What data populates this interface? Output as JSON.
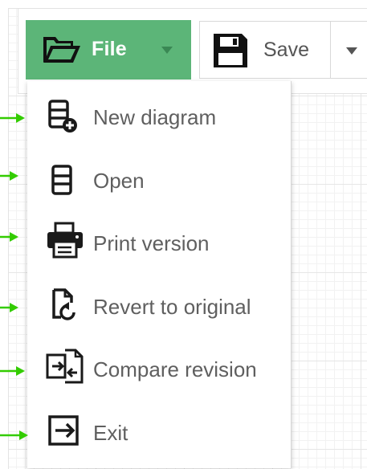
{
  "toolbar": {
    "file_label": "File",
    "save_label": "Save"
  },
  "file_menu": {
    "items": [
      {
        "label": "New diagram",
        "icon": "new-diagram-icon"
      },
      {
        "label": "Open",
        "icon": "open-icon"
      },
      {
        "label": "Print version",
        "icon": "printer-icon"
      },
      {
        "label": "Revert to original",
        "icon": "revert-icon"
      },
      {
        "label": "Compare revision",
        "icon": "compare-icon"
      },
      {
        "label": "Exit",
        "icon": "exit-icon"
      }
    ]
  },
  "colors": {
    "accent_green": "#5cb578",
    "pointer_green": "#33cc00",
    "menu_text": "#5f5f5f",
    "icon_dark": "#1a1a1a"
  }
}
